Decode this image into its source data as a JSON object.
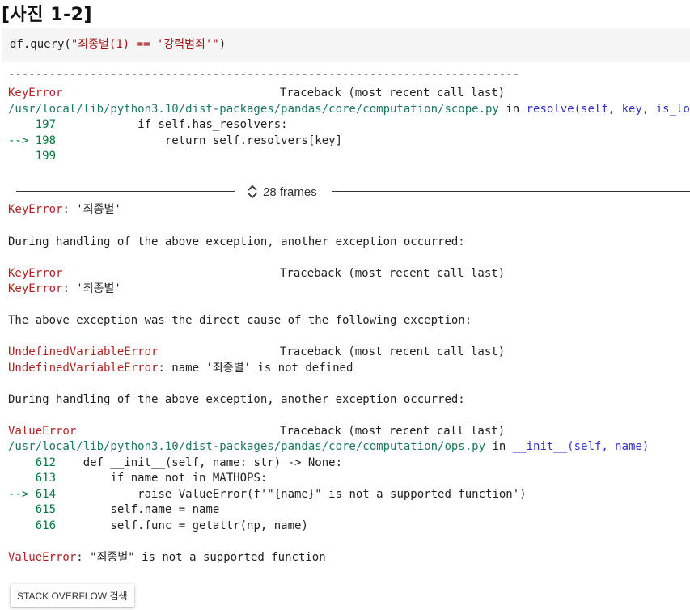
{
  "caption": "[사진 1-2]",
  "cell": {
    "code_prefix": "df.query(",
    "code_string": "\"죄종별(1) == '강력범죄'\"",
    "code_suffix": ")"
  },
  "output": {
    "rule": "---------------------------------------------------------------------------",
    "tb1": {
      "error": "KeyError",
      "traceback": "Traceback (most recent call last)",
      "path": "/usr/local/lib/python3.10/dist-packages/pandas/core/computation/scope.py",
      "in_word": " in ",
      "func": "resolve",
      "args": "(self, key, is_local)",
      "lines": [
        {
          "no": "    197",
          "code": "            if self.has_resolvers:"
        },
        {
          "no": "--> 198",
          "code": "                return self.resolvers[key]"
        },
        {
          "no": "    199",
          "code": ""
        }
      ]
    },
    "frames_label": "28 frames",
    "keyerror1_name": "KeyError",
    "keyerror1_msg": ": '죄종별'",
    "during1": "During handling of the above exception, another exception occurred:",
    "tb2_error": "KeyError",
    "tb2_traceback": "Traceback (most recent call last)",
    "keyerror2_name": "KeyError",
    "keyerror2_msg": ": '죄종별'",
    "direct_cause": "The above exception was the direct cause of the following exception:",
    "tb3_error": "UndefinedVariableError",
    "tb3_traceback": "Traceback (most recent call last)",
    "undef_name": "UndefinedVariableError",
    "undef_msg": ": name '죄종별' is not defined",
    "during2": "During handling of the above exception, another exception occurred:",
    "tb4": {
      "error": "ValueError",
      "traceback": "Traceback (most recent call last)",
      "path": "/usr/local/lib/python3.10/dist-packages/pandas/core/computation/ops.py",
      "in_word": " in ",
      "func": "__init__",
      "args": "(self, name)",
      "lines": [
        {
          "no": "    612",
          "code": "    def __init__(self, name: str) -> None:"
        },
        {
          "no": "    613",
          "code": "        if name not in MATHOPS:"
        },
        {
          "no": "--> 614",
          "code": "            raise ValueError(f'\"{name}\" is not a supported function')"
        },
        {
          "no": "    615",
          "code": "        self.name = name"
        },
        {
          "no": "    616",
          "code": "        self.func = getattr(np, name)"
        }
      ]
    },
    "final_name": "ValueError",
    "final_msg": ": \"죄종별\" is not a supported function"
  },
  "so_button": "STACK OVERFLOW 검색",
  "icons": {
    "frames_toggle": "chevron-up-down-icon"
  }
}
